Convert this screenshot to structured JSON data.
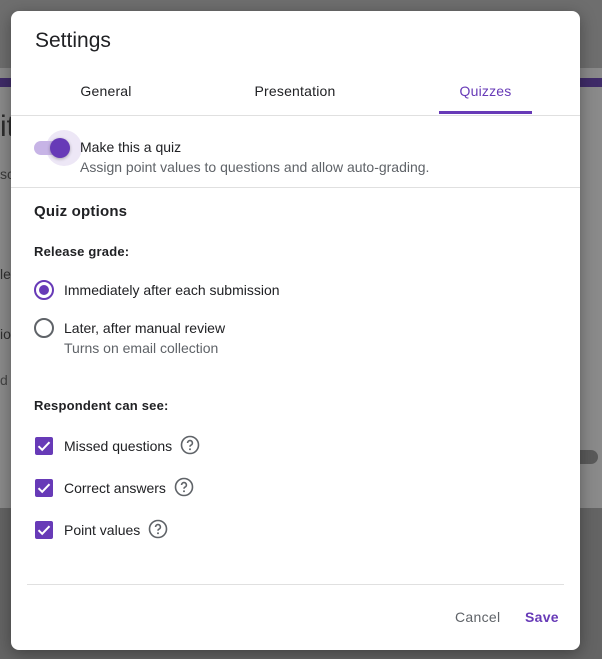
{
  "background": {
    "fragments": [
      "it",
      "sc",
      "le",
      "io",
      "d c"
    ]
  },
  "dialog": {
    "title": "Settings",
    "tabs": [
      {
        "label": "General",
        "active": false
      },
      {
        "label": "Presentation",
        "active": false
      },
      {
        "label": "Quizzes",
        "active": true
      }
    ],
    "quiz_toggle": {
      "label": "Make this a quiz",
      "description": "Assign point values to questions and allow auto-grading.",
      "on": true
    },
    "quiz_options_title": "Quiz options",
    "release_grade": {
      "label": "Release grade:",
      "options": [
        {
          "label": "Immediately after each submission",
          "sublabel": "",
          "selected": true
        },
        {
          "label": "Later, after manual review",
          "sublabel": "Turns on email collection",
          "selected": false
        }
      ]
    },
    "respondent_can_see": {
      "label": "Respondent can see:",
      "items": [
        {
          "label": "Missed questions",
          "checked": true
        },
        {
          "label": "Correct answers",
          "checked": true
        },
        {
          "label": "Point values",
          "checked": true
        }
      ]
    },
    "buttons": {
      "cancel": "Cancel",
      "save": "Save"
    }
  },
  "colors": {
    "accent": "#673ab7",
    "scrim": "#6e6e6e"
  },
  "icons": {
    "help": "help-circle-icon",
    "check": "check-icon"
  }
}
